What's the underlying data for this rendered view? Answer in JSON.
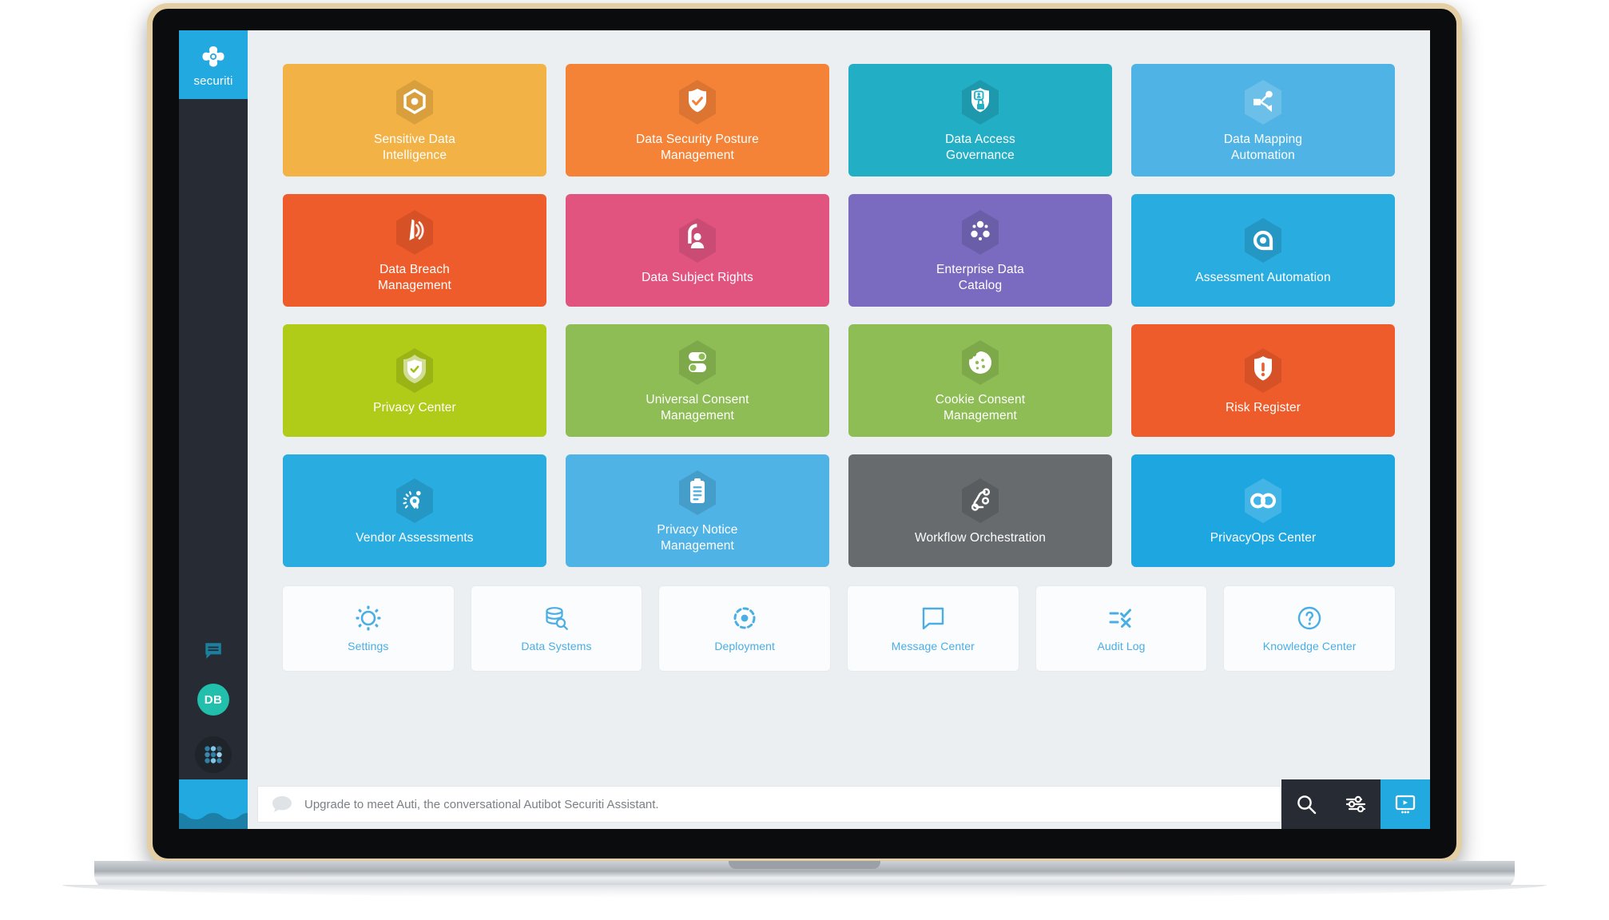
{
  "brand": {
    "name": "securiti",
    "logo_icon": "securiti-atom-logo",
    "color": "#22a9e0"
  },
  "sidebar": {
    "tools": [
      {
        "icon": "message-chat-icon",
        "name": "messages"
      },
      {
        "icon": "user-avatar",
        "name": "user-avatar",
        "initials": "DB",
        "color": "#22bfad"
      },
      {
        "icon": "app-launcher-grid-icon",
        "name": "app-launcher"
      }
    ]
  },
  "tiles": [
    {
      "label": "Sensitive Data\nIntelligence",
      "color": "#f2b245",
      "icon": "hexagon-dot-icon"
    },
    {
      "label": "Data Security Posture\nManagement",
      "color": "#f58337",
      "icon": "shield-check-icon"
    },
    {
      "label": "Data Access\nGovernance",
      "color": "#22aec4",
      "icon": "shield-user-lock-icon"
    },
    {
      "label": "Data Mapping\nAutomation",
      "color": "#4fb3e5",
      "icon": "share-network-icon"
    },
    {
      "label": "Data Breach\nManagement",
      "color": "#ef5c2b",
      "icon": "broadcast-signal-icon"
    },
    {
      "label": "Data Subject Rights",
      "color": "#e15480",
      "icon": "person-rights-icon"
    },
    {
      "label": "Enterprise Data\nCatalog",
      "color": "#7a6bc0",
      "icon": "data-cluster-icon"
    },
    {
      "label": "Assessment Automation",
      "color": "#29ace0",
      "icon": "target-spiral-icon"
    },
    {
      "label": "Privacy Center",
      "color": "#b0cc18",
      "icon": "privacy-shield-icon"
    },
    {
      "label": "Universal Consent\nManagement",
      "color": "#8dbd54",
      "icon": "toggle-switches-icon"
    },
    {
      "label": "Cookie Consent\nManagement",
      "color": "#8dbd54",
      "icon": "cookie-icon"
    },
    {
      "label": "Risk Register",
      "color": "#ef5c2b",
      "icon": "shield-alert-icon"
    },
    {
      "label": "Vendor Assessments",
      "color": "#29ace0",
      "icon": "gauge-meter-icon"
    },
    {
      "label": "Privacy Notice\nManagement",
      "color": "#4fb3e5",
      "icon": "clipboard-icon"
    },
    {
      "label": "Workflow Orchestration",
      "color": "#686b6e",
      "icon": "workflow-branch-icon"
    },
    {
      "label": "PrivacyOps Center",
      "color": "#1ea6e0",
      "icon": "infinity-icon"
    }
  ],
  "quick_links": [
    {
      "label": "Settings",
      "icon": "dotted-gear-icon"
    },
    {
      "label": "Data Systems",
      "icon": "database-search-icon"
    },
    {
      "label": "Deployment",
      "icon": "dotted-circle-dot-icon"
    },
    {
      "label": "Message Center",
      "icon": "speech-bubble-icon"
    },
    {
      "label": "Audit Log",
      "icon": "check-cross-list-icon"
    },
    {
      "label": "Knowledge Center",
      "icon": "question-circle-icon"
    }
  ],
  "quick_link_color": "#4aaee4",
  "bottom_bar": {
    "assistant_prompt": "Upgrade to meet Auti, the conversational Autibot Securiti Assistant.",
    "bubble_icon": "chat-bubble-icon",
    "actions": [
      {
        "icon": "search-icon",
        "name": "search"
      },
      {
        "icon": "sliders-filter-icon",
        "name": "filters"
      },
      {
        "icon": "video-tutorial-icon",
        "name": "tutorial-video",
        "accent": "#22a9e0"
      }
    ]
  }
}
